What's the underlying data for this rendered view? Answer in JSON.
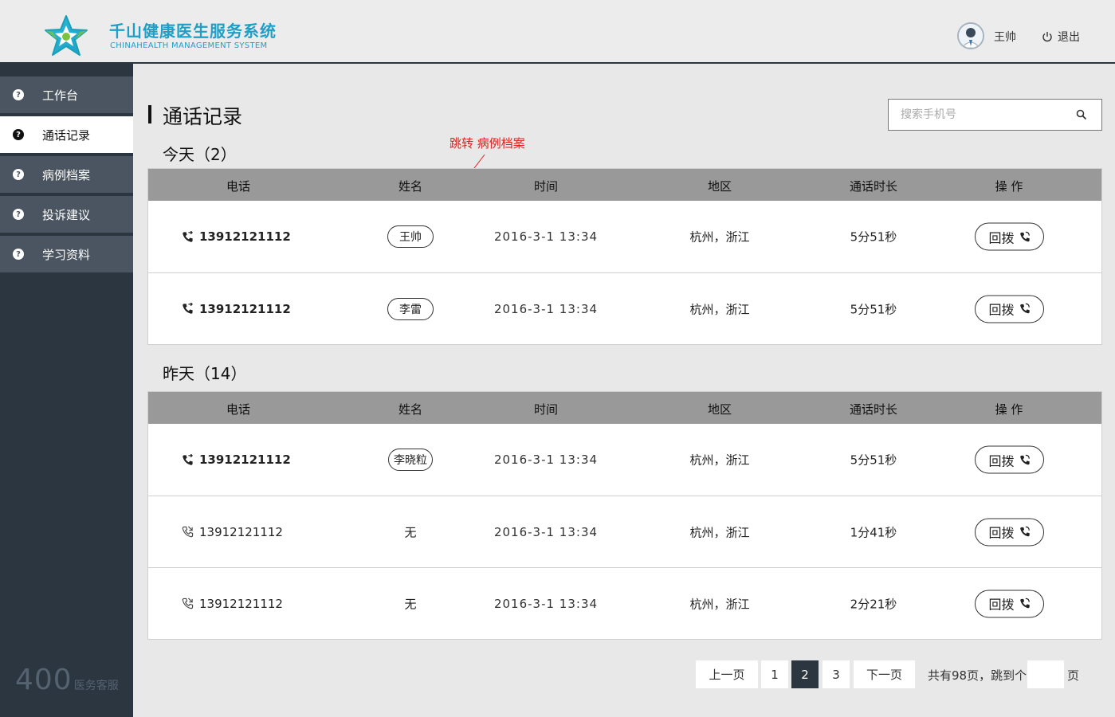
{
  "header": {
    "brand_cn": "千山健康医生服务系统",
    "brand_en": "CHINAHEALTH  MANAGEMENT SYSTEM",
    "user_name": "王帅",
    "logout_label": "退出"
  },
  "sidebar": {
    "items": [
      {
        "label": "工作台",
        "icon": "question-circle-icon"
      },
      {
        "label": "通话记录",
        "icon": "question-circle-icon",
        "active": true
      },
      {
        "label": "病例档案",
        "icon": "question-circle-icon"
      },
      {
        "label": "投诉建议",
        "icon": "question-circle-icon"
      },
      {
        "label": "学习资料",
        "icon": "question-circle-icon"
      }
    ],
    "hotline_number": "400",
    "hotline_label": "医务客服"
  },
  "page": {
    "title": "通话记录",
    "search_placeholder": "搜索手机号",
    "annotation": "跳转 病例档案"
  },
  "columns": [
    "电话",
    "姓名",
    "时间",
    "地区",
    "通话时长",
    "操 作"
  ],
  "sections": [
    {
      "title": "今天（2）",
      "rows": [
        {
          "phone": "13912121112",
          "name": "王帅",
          "time": "2016-3-1 13:34",
          "region": "杭州，浙江",
          "duration": "5分51秒",
          "action": "回拨"
        },
        {
          "phone": "13912121112",
          "name": "李雷",
          "time": "2016-3-1 13:34",
          "region": "杭州，浙江",
          "duration": "5分51秒",
          "action": "回拨"
        }
      ]
    },
    {
      "title": "昨天（14）",
      "rows": [
        {
          "phone": "13912121112",
          "name": "李晓粒",
          "time": "2016-3-1 13:34",
          "region": "杭州，浙江",
          "duration": "5分51秒",
          "action": "回拨"
        },
        {
          "phone": "13912121112",
          "name": "无",
          "time": "2016-3-1 13:34",
          "region": "杭州，浙江",
          "duration": "1分41秒",
          "action": "回拨"
        },
        {
          "phone": "13912121112",
          "name": "无",
          "time": "2016-3-1 13:34",
          "region": "杭州，浙江",
          "duration": "2分21秒",
          "action": "回拨"
        }
      ]
    }
  ],
  "pagination": {
    "prev": "上一页",
    "pages": [
      "1",
      "2",
      "3"
    ],
    "current": "2",
    "next": "下一页",
    "total_text": "共有98页，跳到个",
    "page_suffix": "页"
  },
  "colors": {
    "brand": "#1e9fc8",
    "sidebar_bg": "#2c3641",
    "nav_item_bg": "#4a5561",
    "table_header_bg": "#999999",
    "annotation": "#e02020"
  }
}
